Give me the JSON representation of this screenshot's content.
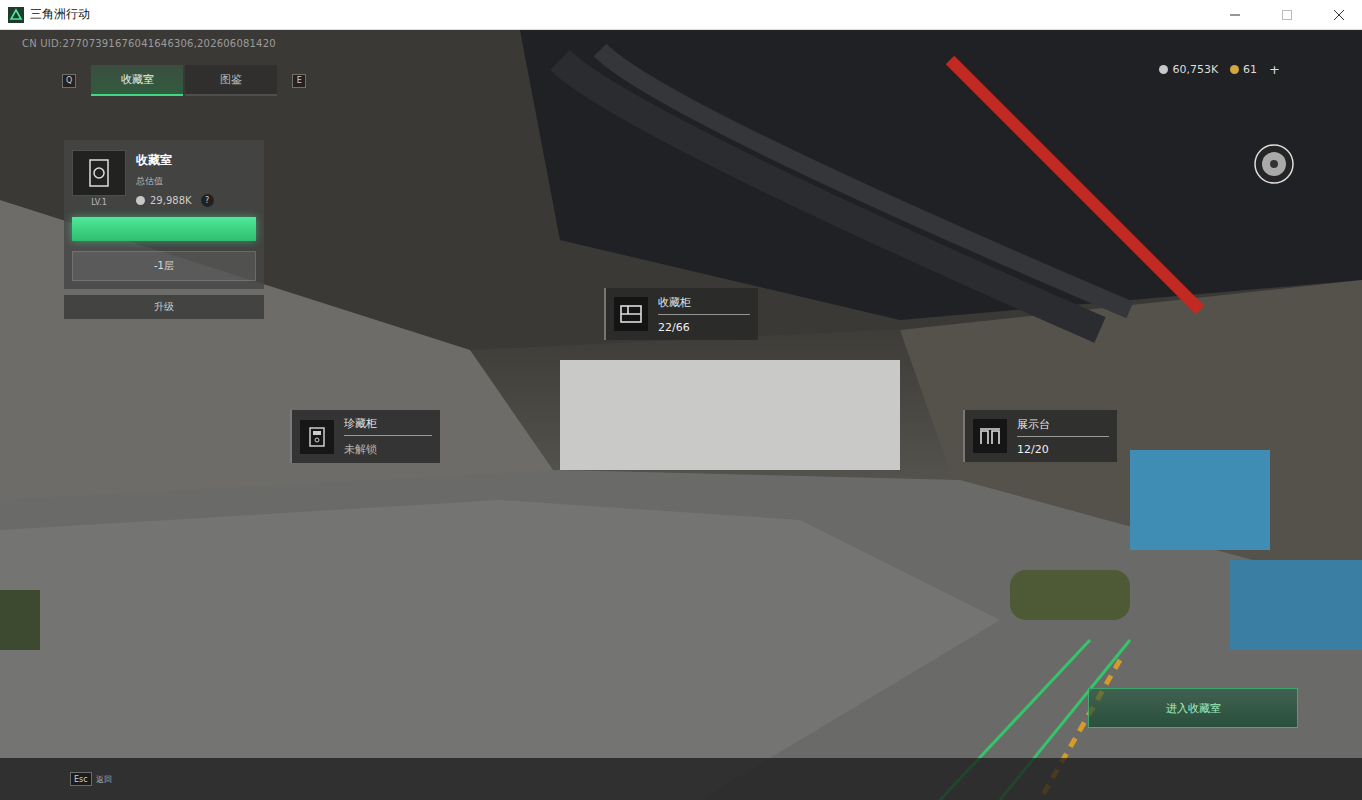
{
  "window": {
    "title": "三角洲行动"
  },
  "uid": "CN UID:27707391676041646306,202606081420",
  "tabs": {
    "prev_key": "Q",
    "next_key": "E",
    "items": [
      {
        "label": "收藏室",
        "selected": true
      },
      {
        "label": "图鉴",
        "selected": false
      }
    ]
  },
  "currency": [
    {
      "value": "60,753K"
    },
    {
      "value": "61"
    }
  ],
  "currency_add": "+",
  "room_card": {
    "title": "收藏室",
    "subtitle": "总估值",
    "level": "LV.1",
    "value": "29,988K",
    "help": "?",
    "progress": 1,
    "floor": "-1层",
    "upgrade": "升级"
  },
  "hotspots": [
    {
      "name": "收藏柜",
      "count": "22/66",
      "locked": false
    },
    {
      "name": "珍藏柜",
      "count": "未解锁",
      "locked": true
    },
    {
      "name": "展示台",
      "count": "12/20",
      "locked": false
    }
  ],
  "enter_button": "进入收藏室",
  "back": {
    "key": "Esc",
    "label": "返回"
  }
}
